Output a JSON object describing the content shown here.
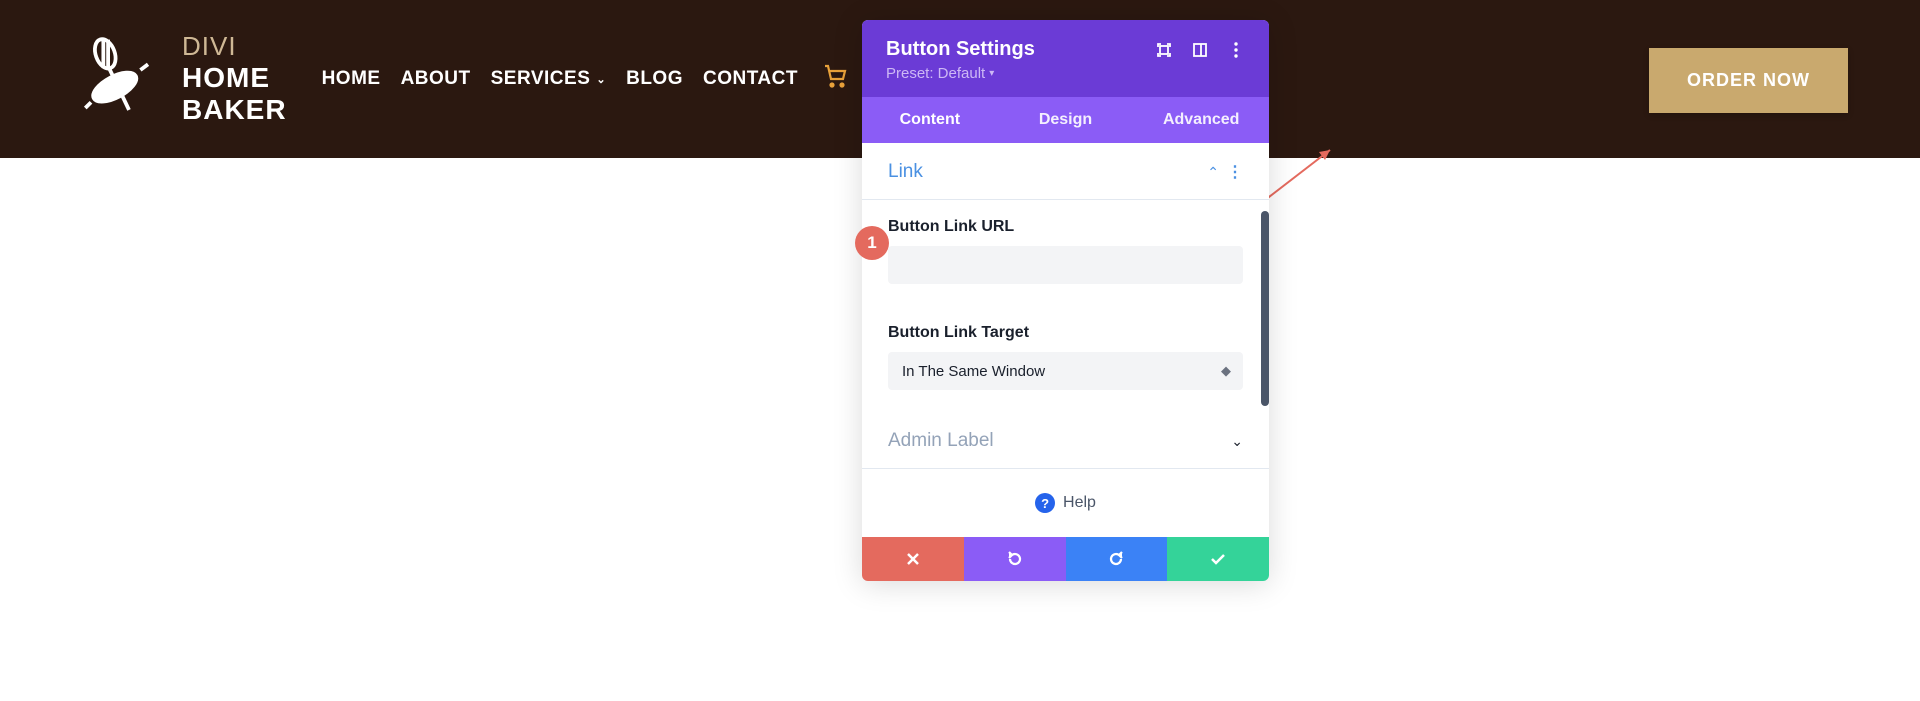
{
  "logo": {
    "line1": "DIVI",
    "line2": "HOME",
    "line3": "BAKER"
  },
  "nav": {
    "items": [
      "HOME",
      "ABOUT",
      "SERVICES",
      "BLOG",
      "CONTACT"
    ],
    "services_has_dropdown": true
  },
  "cta": {
    "label": "ORDER NOW"
  },
  "annotation": {
    "badge": "1"
  },
  "panel": {
    "title": "Button Settings",
    "preset": "Preset: Default",
    "tabs": [
      "Content",
      "Design",
      "Advanced"
    ],
    "active_tab": 0,
    "sections": {
      "link": {
        "title": "Link",
        "url_label": "Button Link URL",
        "url_value": "",
        "target_label": "Button Link Target",
        "target_value": "In The Same Window"
      },
      "admin": {
        "title": "Admin Label"
      }
    },
    "help": "Help"
  }
}
